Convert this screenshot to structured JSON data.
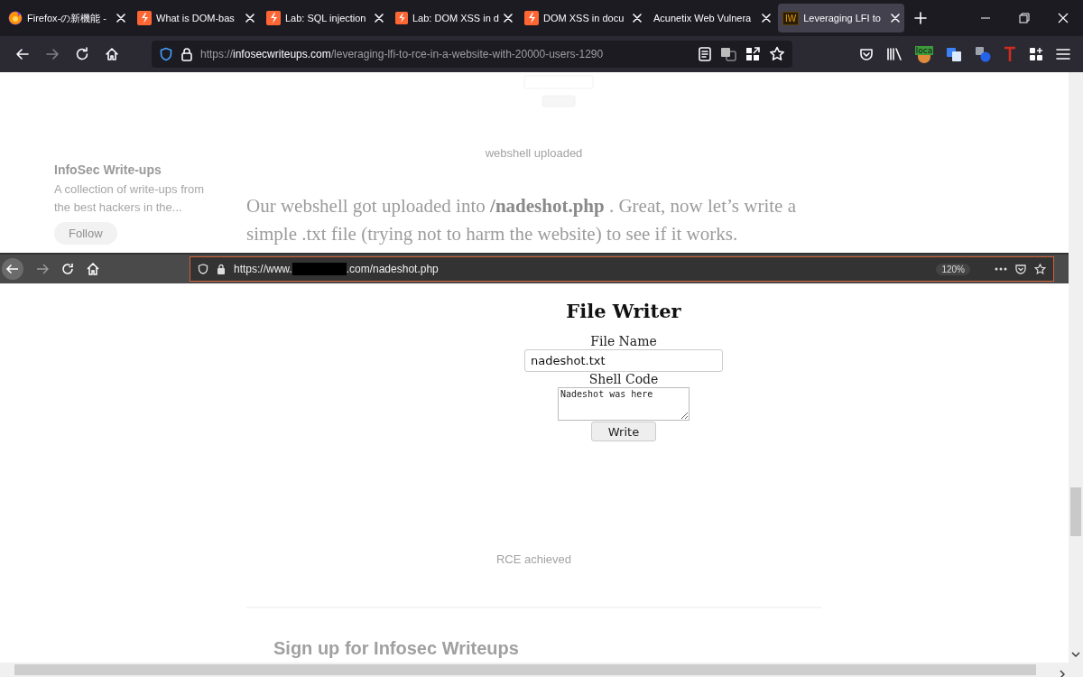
{
  "tabs": [
    {
      "title": "Firefox-の新機能 -",
      "kind": "firefox",
      "selected": false
    },
    {
      "title": "What is DOM-bas",
      "kind": "lightning",
      "selected": false
    },
    {
      "title": "Lab: SQL injection",
      "kind": "lightning",
      "selected": false
    },
    {
      "title": "Lab: DOM XSS in d",
      "kind": "lightning",
      "selected": false
    },
    {
      "title": "DOM XSS in docu",
      "kind": "lightning",
      "selected": false
    },
    {
      "title": "Acunetix Web Vulnera",
      "kind": "plain",
      "selected": false
    },
    {
      "title": "Leveraging LFI to",
      "kind": "logo",
      "logo_text": "IW",
      "selected": true
    }
  ],
  "navigation": {
    "forward_disabled": true
  },
  "address_bar": {
    "scheme": "https://",
    "host": "infosecwriteups.com",
    "path": "/leveraging-lfi-to-rce-in-a-website-with-20000-users-1290"
  },
  "extension_badge": "loca",
  "article": {
    "top_caption": "webshell uploaded",
    "sidebar": {
      "title": "InfoSec Write-ups",
      "description": "A collection of write-ups from the best hackers in the...",
      "follow_button": "Follow"
    },
    "paragraph": "Our webshell got uploaded into **/nadeshot.php** . Great, now let’s write a simple .txt file (trying not to harm the website) to see if it works.",
    "bottom_caption": "RCE achieved",
    "signup_heading": "Sign up for Infosec Writeups"
  },
  "zoomed_image": {
    "forward_disabled": true,
    "url_before": "https://www.",
    "redacted": true,
    "url_after": ".com/nadeshot.php",
    "zoom": "120%",
    "title": "File Writer",
    "fields": [
      {
        "label": "File Name",
        "kind": "input",
        "value": "nadeshot.txt"
      },
      {
        "label": "Shell Code",
        "kind": "textarea",
        "value": "Nadeshot was here"
      }
    ],
    "button": "Write"
  }
}
